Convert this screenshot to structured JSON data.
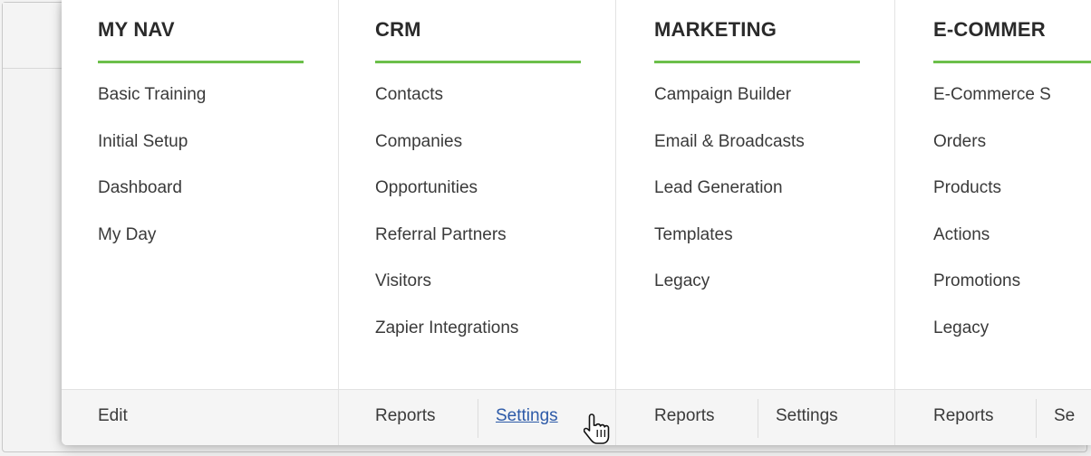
{
  "columns": [
    {
      "title": "MY NAV",
      "items": [
        "Basic Training",
        "Initial Setup",
        "Dashboard",
        "My Day"
      ]
    },
    {
      "title": "CRM",
      "items": [
        "Contacts",
        "Companies",
        "Opportunities",
        "Referral Partners",
        "Visitors",
        "Zapier Integrations"
      ]
    },
    {
      "title": "MARKETING",
      "items": [
        "Campaign Builder",
        "Email & Broadcasts",
        "Lead Generation",
        "Templates",
        "Legacy"
      ]
    },
    {
      "title": "E-COMMER",
      "items": [
        "E-Commerce S",
        "Orders",
        "Products",
        "Actions",
        "Promotions",
        "Legacy"
      ]
    }
  ],
  "footer": {
    "my_nav": {
      "edit": "Edit"
    },
    "crm": {
      "reports": "Reports",
      "settings": "Settings"
    },
    "marketing": {
      "reports": "Reports",
      "settings": "Settings"
    },
    "ecommerce": {
      "reports": "Reports",
      "settings": "Se"
    }
  },
  "cursor_icon": "hand-pointer-icon",
  "accent_color": "#6cbf4a",
  "link_color": "#2d5aa8"
}
